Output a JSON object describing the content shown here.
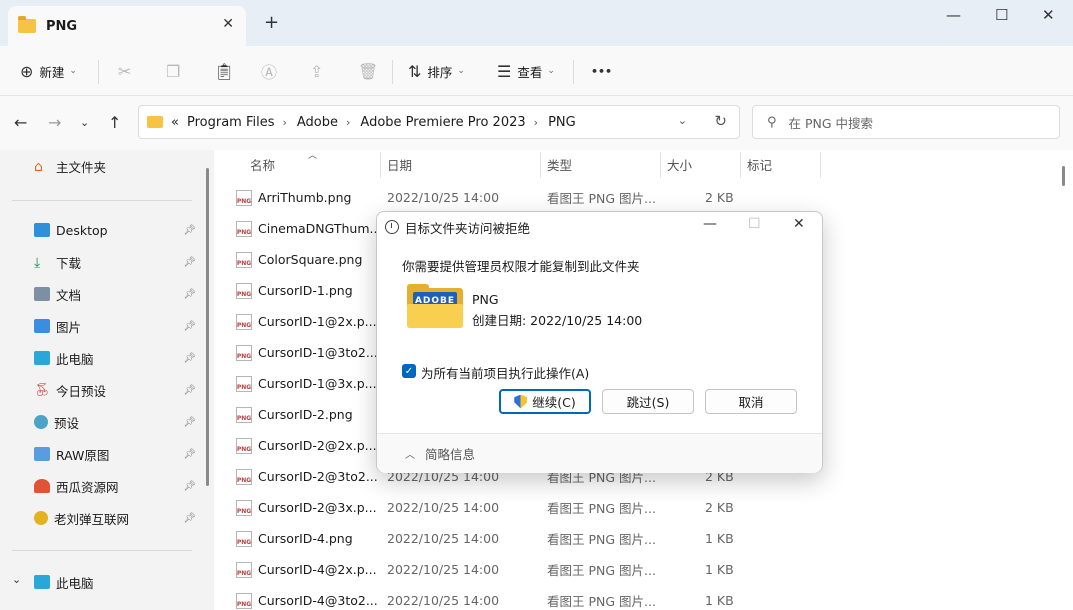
{
  "window": {
    "tab_title": "PNG",
    "tab_close": "✕",
    "new_tab": "+",
    "minimize": "—",
    "maximize": "☐",
    "close": "✕"
  },
  "toolbar": {
    "new_label": "新建",
    "sort_label": "排序",
    "view_label": "查看",
    "more": "•••"
  },
  "address": {
    "overflow": "«",
    "crumbs": [
      "Program Files",
      "Adobe",
      "Adobe Premiere Pro 2023",
      "PNG"
    ],
    "search_placeholder": "在 PNG 中搜索"
  },
  "sidebar": {
    "home": "主文件夹",
    "quick": [
      "Desktop",
      "下载",
      "文档",
      "图片",
      "此电脑",
      "今日预设",
      "预设",
      "RAW原图",
      "西瓜资源网",
      "老刘弹互联网"
    ],
    "this_pc": "此电脑"
  },
  "columns": {
    "name": "名称",
    "date": "日期",
    "type": "类型",
    "size": "大小",
    "tags": "标记"
  },
  "files": [
    {
      "name": "ArriThumb.png",
      "date": "2022/10/25 14:00",
      "type": "看图王 PNG 图片...",
      "size": "2 KB"
    },
    {
      "name": "CinemaDNGThum...",
      "date": "",
      "type": "",
      "size": ""
    },
    {
      "name": "ColorSquare.png",
      "date": "",
      "type": "",
      "size": ""
    },
    {
      "name": "CursorID-1.png",
      "date": "",
      "type": "",
      "size": ""
    },
    {
      "name": "CursorID-1@2x.p...",
      "date": "",
      "type": "",
      "size": ""
    },
    {
      "name": "CursorID-1@3to2...",
      "date": "",
      "type": "",
      "size": ""
    },
    {
      "name": "CursorID-1@3x.p...",
      "date": "",
      "type": "",
      "size": ""
    },
    {
      "name": "CursorID-2.png",
      "date": "",
      "type": "",
      "size": ""
    },
    {
      "name": "CursorID-2@2x.p...",
      "date": "",
      "type": "",
      "size": ""
    },
    {
      "name": "CursorID-2@3to2...",
      "date": "2022/10/25 14:00",
      "type": "看图王 PNG 图片...",
      "size": "2 KB"
    },
    {
      "name": "CursorID-2@3x.p...",
      "date": "2022/10/25 14:00",
      "type": "看图王 PNG 图片...",
      "size": "2 KB"
    },
    {
      "name": "CursorID-4.png",
      "date": "2022/10/25 14:00",
      "type": "看图王 PNG 图片...",
      "size": "1 KB"
    },
    {
      "name": "CursorID-4@2x.p...",
      "date": "2022/10/25 14:00",
      "type": "看图王 PNG 图片...",
      "size": "1 KB"
    },
    {
      "name": "CursorID-4@3to2...",
      "date": "2022/10/25 14:00",
      "type": "看图王 PNG 图片...",
      "size": "1 KB"
    }
  ],
  "dialog": {
    "title": "目标文件夹访问被拒绝",
    "message": "你需要提供管理员权限才能复制到此文件夹",
    "folder_art": "ADOBE",
    "folder_name": "PNG",
    "folder_date": "创建日期: 2022/10/25 14:00",
    "checkbox_label": "为所有当前项目执行此操作(A)",
    "continue": "继续(C)",
    "skip": "跳过(S)",
    "cancel": "取消",
    "details": "简略信息"
  },
  "colors": {
    "accent": "#0067c0",
    "folder": "#f6c343"
  }
}
